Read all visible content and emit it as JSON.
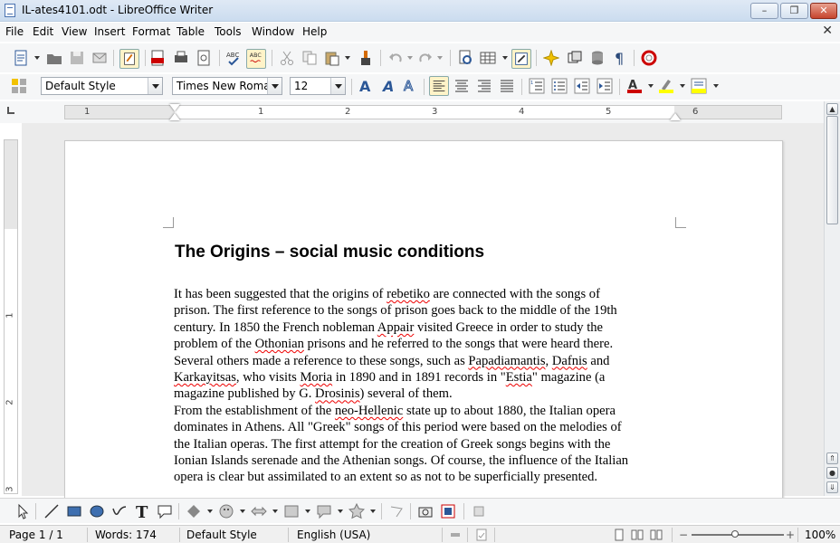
{
  "window": {
    "title": "IL-ates4101.odt - LibreOffice Writer",
    "min": "–",
    "max": "❐",
    "close": "✕"
  },
  "menu": [
    "File",
    "Edit",
    "View",
    "Insert",
    "Format",
    "Table",
    "Tools",
    "Window",
    "Help"
  ],
  "formatting": {
    "style": "Default Style",
    "font": "Times New Roman",
    "size": "12"
  },
  "ruler": {
    "marks": [
      "1",
      "1",
      "2",
      "3",
      "4",
      "5",
      "6"
    ],
    "vmarks": [
      "1",
      "2",
      "3"
    ]
  },
  "document": {
    "heading": "The Origins – social music conditions",
    "para1": [
      [
        {
          "t": "It has been suggested that the origins of "
        },
        {
          "t": "rebetiko",
          "s": true
        },
        {
          "t": " are connected with the songs of"
        }
      ],
      [
        {
          "t": "prison. The first reference to the songs of prison goes back to the middle of the 19th"
        }
      ],
      [
        {
          "t": "century. In 1850 the French nobleman "
        },
        {
          "t": "Appair",
          "s": true
        },
        {
          "t": " visited Greece in order to study the"
        }
      ],
      [
        {
          "t": "problem of the "
        },
        {
          "t": "Othonian",
          "s": true
        },
        {
          "t": " prisons and he referred to the songs that were heard there."
        }
      ],
      [
        {
          "t": "Several others made a reference to these songs, such as "
        },
        {
          "t": "Papadiamantis",
          "s": true
        },
        {
          "t": ", "
        },
        {
          "t": "Dafnis",
          "s": true
        },
        {
          "t": " and"
        }
      ],
      [
        {
          "t": "Karkayitsas",
          "s": true
        },
        {
          "t": ", who visits "
        },
        {
          "t": "Moria",
          "s": true
        },
        {
          "t": " in  1890 and in 1891 records in \""
        },
        {
          "t": "Estia",
          "s": true
        },
        {
          "t": "\" magazine (a"
        }
      ],
      [
        {
          "t": "magazine published by G. "
        },
        {
          "t": "Drosinis",
          "s": true
        },
        {
          "t": ") several of them."
        }
      ]
    ],
    "para2": [
      [
        {
          "t": "From the establishment of the "
        },
        {
          "t": "neo-Hellenic",
          "s": true
        },
        {
          "t": " state up to about 1880, the Italian opera"
        }
      ],
      [
        {
          "t": "dominates in Athens. All \"Greek\" songs of this period were based on the melodies of"
        }
      ],
      [
        {
          "t": "the Italian operas. The first attempt for the creation of Greek songs begins with the"
        }
      ],
      [
        {
          "t": "Ionian Islands serenade and the Athenian songs. Of course, the influence of the Italian"
        }
      ],
      [
        {
          "t": "opera is clear but assimilated to an extent so as not to be superficially presented."
        }
      ]
    ]
  },
  "status": {
    "page": "Page 1 / 1",
    "words": "Words: 174",
    "style": "Default Style",
    "lang": "English (USA)",
    "zoom": "100%"
  },
  "icons": {
    "text_tool": "T"
  }
}
